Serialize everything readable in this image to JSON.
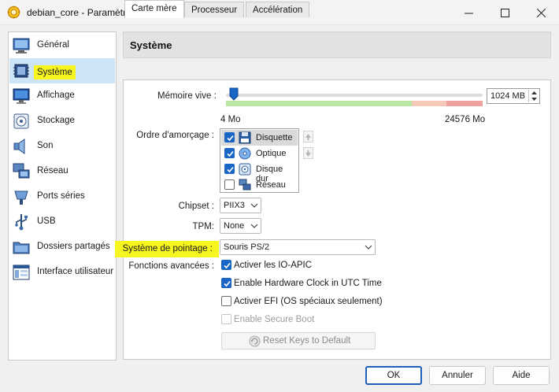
{
  "window": {
    "title": "debian_core - Paramètres"
  },
  "nav": {
    "items": [
      {
        "label": "Général",
        "icon": "general-icon"
      },
      {
        "label": "Système",
        "icon": "system-chip-icon"
      },
      {
        "label": "Affichage",
        "icon": "monitor-icon"
      },
      {
        "label": "Stockage",
        "icon": "storage-disk-icon"
      },
      {
        "label": "Son",
        "icon": "speaker-icon"
      },
      {
        "label": "Réseau",
        "icon": "network-icon"
      },
      {
        "label": "Ports séries",
        "icon": "serial-port-icon"
      },
      {
        "label": "USB",
        "icon": "usb-icon"
      },
      {
        "label": "Dossiers partagés",
        "icon": "shared-folder-icon"
      },
      {
        "label": "Interface utilisateur",
        "icon": "user-interface-icon"
      }
    ],
    "selected": "Système"
  },
  "page": {
    "title": "Système"
  },
  "tabs": [
    {
      "label": "Carte mère",
      "active": true
    },
    {
      "label": "Processeur",
      "active": false
    },
    {
      "label": "Accélération",
      "active": false
    }
  ],
  "memory": {
    "label": "Mémoire vive :",
    "min_label": "4 Mo",
    "max_label": "24576 Mo",
    "value": "1024 MB",
    "slider_level_percent": 4
  },
  "boot": {
    "label": "Ordre d'amorçage :",
    "items": [
      {
        "label": "Disquette",
        "checked": true,
        "icon": "floppy-icon"
      },
      {
        "label": "Optique",
        "checked": true,
        "icon": "optical-disc-icon"
      },
      {
        "label": "Disque dur",
        "checked": true,
        "icon": "hard-disk-icon"
      },
      {
        "label": "Réseau",
        "checked": false,
        "icon": "network-boot-icon"
      }
    ]
  },
  "chipset": {
    "label": "Chipset :",
    "value": "PIIX3"
  },
  "tpm": {
    "label": "TPM:",
    "value": "None"
  },
  "pointing": {
    "label": "Système de pointage :",
    "value": "Souris PS/2"
  },
  "features": {
    "label": "Fonctions avancées :",
    "options": [
      {
        "label": "Activer les IO-APIC",
        "checked": true,
        "enabled": true
      },
      {
        "label": "Enable Hardware Clock in UTC Time",
        "checked": true,
        "enabled": true
      },
      {
        "label": "Activer EFI (OS spéciaux seulement)",
        "checked": false,
        "enabled": true
      },
      {
        "label": "Enable Secure Boot",
        "checked": false,
        "enabled": false
      }
    ],
    "reset_button": "Reset Keys to Default"
  },
  "buttons": {
    "ok": "OK",
    "cancel": "Annuler",
    "help": "Aide"
  },
  "colors": {
    "accent": "#1a66c6",
    "selected_nav": "#cde3f6",
    "highlight": "#f6f51e"
  }
}
